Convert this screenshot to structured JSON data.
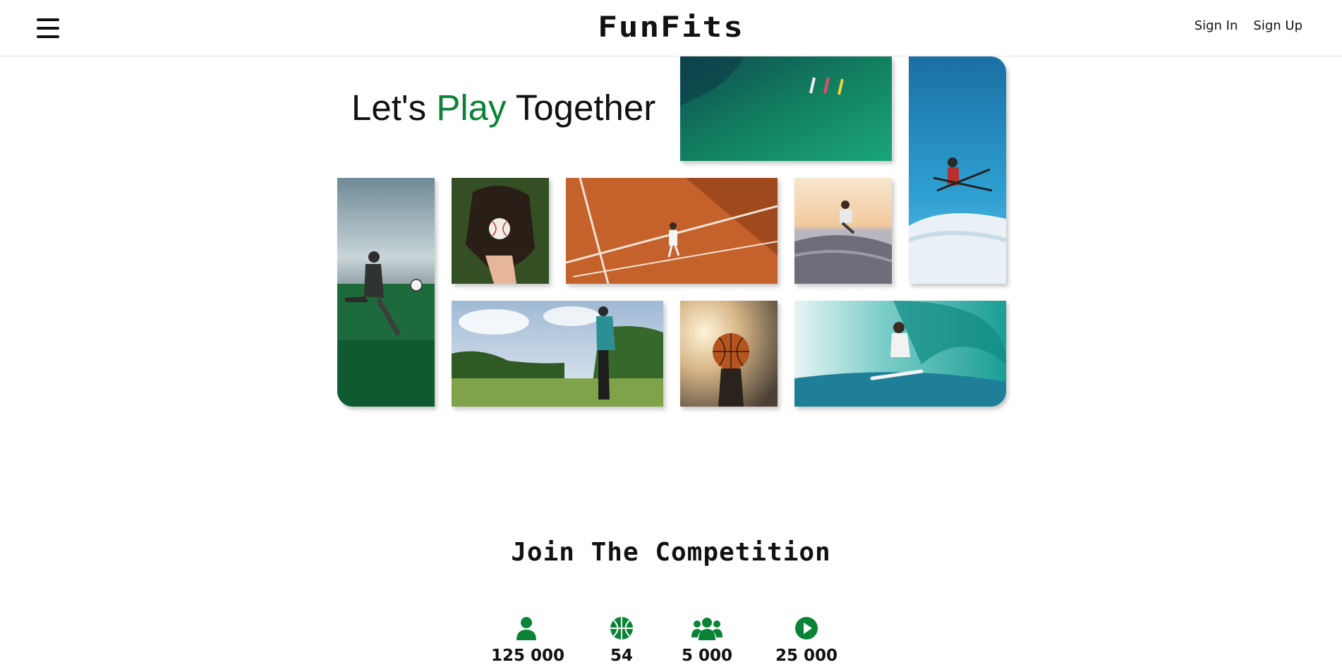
{
  "header": {
    "logo": "FunFits",
    "menu_icon": "hamburger-menu-icon",
    "sign_in": "Sign In",
    "sign_up": "Sign Up"
  },
  "hero": {
    "title_part1": "Let's",
    "title_accent": "Play",
    "title_part2": "Together",
    "accent_color": "#0a8336"
  },
  "gallery": [
    {
      "name": "kayaking-photo"
    },
    {
      "name": "skiing-photo"
    },
    {
      "name": "soccer-photo"
    },
    {
      "name": "baseball-glove-photo"
    },
    {
      "name": "tennis-photo"
    },
    {
      "name": "skateboarding-photo"
    },
    {
      "name": "golf-photo"
    },
    {
      "name": "basketball-photo"
    },
    {
      "name": "surfing-photo"
    }
  ],
  "competition": {
    "title": "Join The Competition",
    "stats": [
      {
        "icon": "user-icon",
        "value": "125 000"
      },
      {
        "icon": "basketball-icon",
        "value": "54"
      },
      {
        "icon": "users-group-icon",
        "value": "5 000"
      },
      {
        "icon": "play-circle-icon",
        "value": "25 000"
      }
    ]
  }
}
